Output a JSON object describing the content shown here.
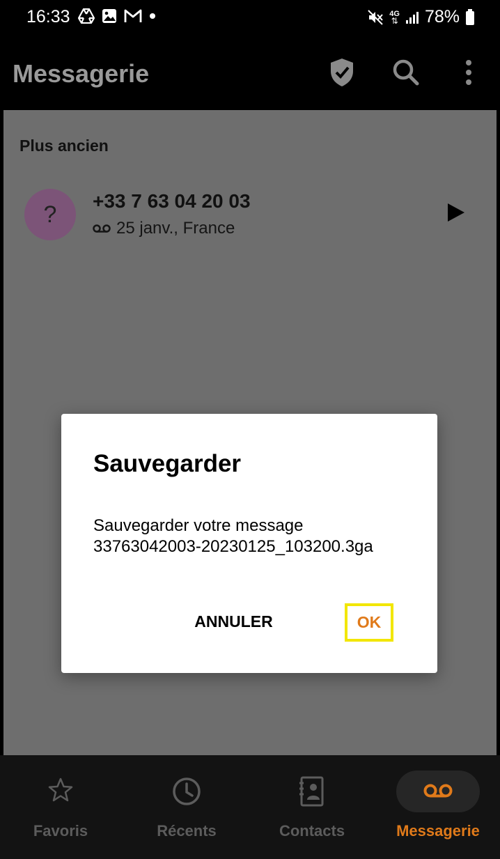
{
  "status_bar": {
    "time": "16:33",
    "left_icons": [
      "drive-icon",
      "image-icon",
      "gmail-icon",
      "dot-icon"
    ],
    "right_icons": [
      "mute-icon",
      "network-4g-icon",
      "signal-icon",
      "battery-icon"
    ],
    "network_label": "4G",
    "battery_percent": "78%"
  },
  "app_bar": {
    "title": "Messagerie",
    "actions": [
      "shield-check-icon",
      "search-icon",
      "more-vert-icon"
    ]
  },
  "content": {
    "section_header": "Plus ancien",
    "voicemails": [
      {
        "avatar_glyph": "?",
        "number": "+33 7 63 04 20 03",
        "meta": "25 janv., France",
        "meta_icon": "voicemail-icon",
        "action_icon": "play-icon"
      }
    ]
  },
  "dialog": {
    "title": "Sauvegarder",
    "body_line1": "Sauvegarder votre message",
    "body_line2": "33763042003-20230125_103200.3ga",
    "cancel_label": "ANNULER",
    "ok_label": "OK"
  },
  "bottom_nav": {
    "items": [
      {
        "label": "Favoris",
        "icon": "star-icon"
      },
      {
        "label": "Récents",
        "icon": "clock-icon"
      },
      {
        "label": "Contacts",
        "icon": "contacts-icon"
      },
      {
        "label": "Messagerie",
        "icon": "voicemail-icon"
      }
    ],
    "active_index": 3
  },
  "colors": {
    "accent": "#e07a1a",
    "highlight_border": "#f2e600",
    "avatar_bg": "#7c5478",
    "scrim_content": "#6e6e6e"
  }
}
